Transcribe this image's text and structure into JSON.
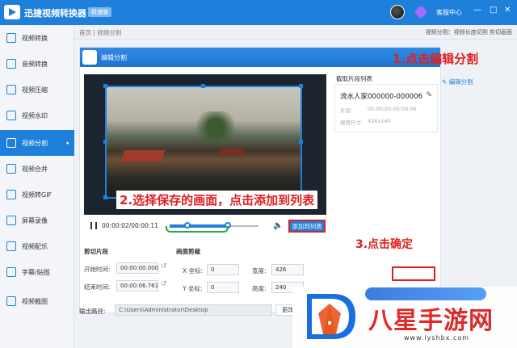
{
  "app": {
    "title": "迅捷视频转换器",
    "edition": "极速版",
    "help": "客服中心",
    "min": "—",
    "close": "✕",
    "max": "□"
  },
  "sidebar": {
    "items": [
      {
        "label": "视频转换",
        "icon": "video-convert-icon"
      },
      {
        "label": "音频转换",
        "icon": "audio-convert-icon"
      },
      {
        "label": "视频压缩",
        "icon": "video-compress-icon"
      },
      {
        "label": "视频水印",
        "icon": "watermark-icon"
      },
      {
        "label": "视频分割",
        "icon": "video-split-icon",
        "active": true
      },
      {
        "label": "视频合并",
        "icon": "video-merge-icon"
      },
      {
        "label": "视频转GIF",
        "icon": "gif-icon"
      },
      {
        "label": "屏幕录像",
        "icon": "screen-record-icon"
      },
      {
        "label": "视频配乐",
        "icon": "music-icon"
      },
      {
        "label": "字幕/贴图",
        "icon": "subtitle-icon"
      },
      {
        "label": "视频截图",
        "icon": "screenshot-icon"
      }
    ],
    "arrow": "▸"
  },
  "header": {
    "breadcrumb": "首页 | 视频分割",
    "right_hint": "视频分割：视频长度切割 剪切画面"
  },
  "panel": {
    "title": "编辑分割"
  },
  "player": {
    "timecode": "00:00:02/00:00:11",
    "add_button": "添加到列表",
    "mute": "🔈"
  },
  "cut": {
    "section": "剪切片段",
    "start_label": "开始时间:",
    "start_value": "00:00:00.000",
    "end_label": "结束时间:",
    "end_value": "00:00:06.761"
  },
  "crop": {
    "section": "画面剪裁",
    "x_label": "X 坐标:",
    "x_value": "0",
    "y_label": "Y 坐标:",
    "y_value": "0",
    "w_label": "宽度:",
    "w_value": "426",
    "h_label": "高度:",
    "h_value": "240"
  },
  "clip_list": {
    "title": "截取片段列表",
    "name": "流水人家000000-000006",
    "duration_label": "片段:",
    "duration_value": "00:00:00-00:00:06",
    "size_label": "视频尺寸:",
    "size_value": "426x240"
  },
  "output": {
    "label": "输出路径:",
    "path": "C:\\Users\\Administrator\\Desktop",
    "change": "更改"
  },
  "annotations": {
    "step1": "1.点击编辑分割",
    "step2": "2.选择保存的画面，点击添加到列表",
    "step3": "3.点击确定",
    "edit_link": "编辑分割"
  },
  "watermark": {
    "main": "八星手游网",
    "url": "www.lyshbx.com"
  },
  "colors": {
    "accent": "#1f80db",
    "annotation": "#e02020",
    "bracket": "#22aa44"
  }
}
